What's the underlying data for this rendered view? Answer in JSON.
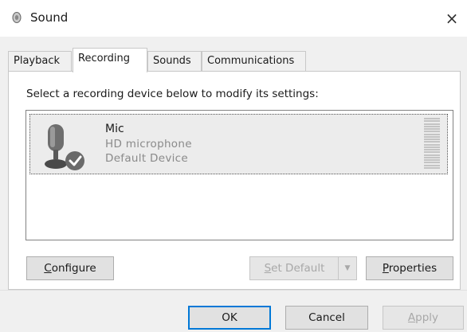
{
  "window": {
    "title": "Sound",
    "icon": "speaker-icon",
    "close_label": "×"
  },
  "tabs": [
    {
      "label": "Playback",
      "active": false
    },
    {
      "label": "Recording",
      "active": true
    },
    {
      "label": "Sounds",
      "active": false
    },
    {
      "label": "Communications",
      "active": false
    }
  ],
  "panel": {
    "instructions": "Select a recording device below to modify its settings:",
    "devices": [
      {
        "name": "Mic",
        "description": "HD  microphone",
        "status": "Default Device",
        "icon": "microphone-icon",
        "badge_icon": "checkmark-icon",
        "level": 0
      }
    ],
    "buttons": {
      "configure": {
        "accel": "C",
        "rest": "onfigure"
      },
      "set_default": {
        "accel": "S",
        "rest": "et Default",
        "arrow": "▼"
      },
      "properties": {
        "accel": "P",
        "rest": "roperties"
      }
    }
  },
  "footer": {
    "ok": "OK",
    "cancel": "Cancel",
    "apply": {
      "accel": "A",
      "rest": "pply"
    }
  },
  "colors": {
    "window_bg": "#f0f0f0",
    "panel_bg": "#ffffff",
    "selected_item_bg": "#ececec",
    "disabled_text": "#a8a8a8",
    "default_button_border": "#0078d7"
  }
}
